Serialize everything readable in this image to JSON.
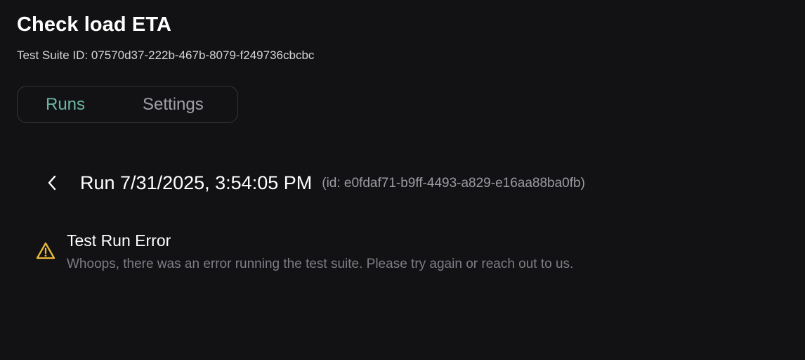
{
  "header": {
    "title": "Check load ETA",
    "suite_id": "Test Suite ID: 07570d37-222b-467b-8079-f249736cbcbc"
  },
  "tabs": [
    {
      "label": "Runs",
      "active": true
    },
    {
      "label": "Settings",
      "active": false
    }
  ],
  "run": {
    "back_icon": "chevron-left-icon",
    "title": "Run 7/31/2025, 3:54:05 PM",
    "id_text": "(id: e0fdaf71-b9ff-4493-a829-e16aa88ba0fb)"
  },
  "error": {
    "icon": "warning-icon",
    "icon_color": "#e8b93a",
    "title": "Test Run Error",
    "message": "Whoops, there was an error running the test suite. Please try again or reach out to us."
  },
  "colors": {
    "background": "#121214",
    "accent": "#6cb6a3"
  }
}
